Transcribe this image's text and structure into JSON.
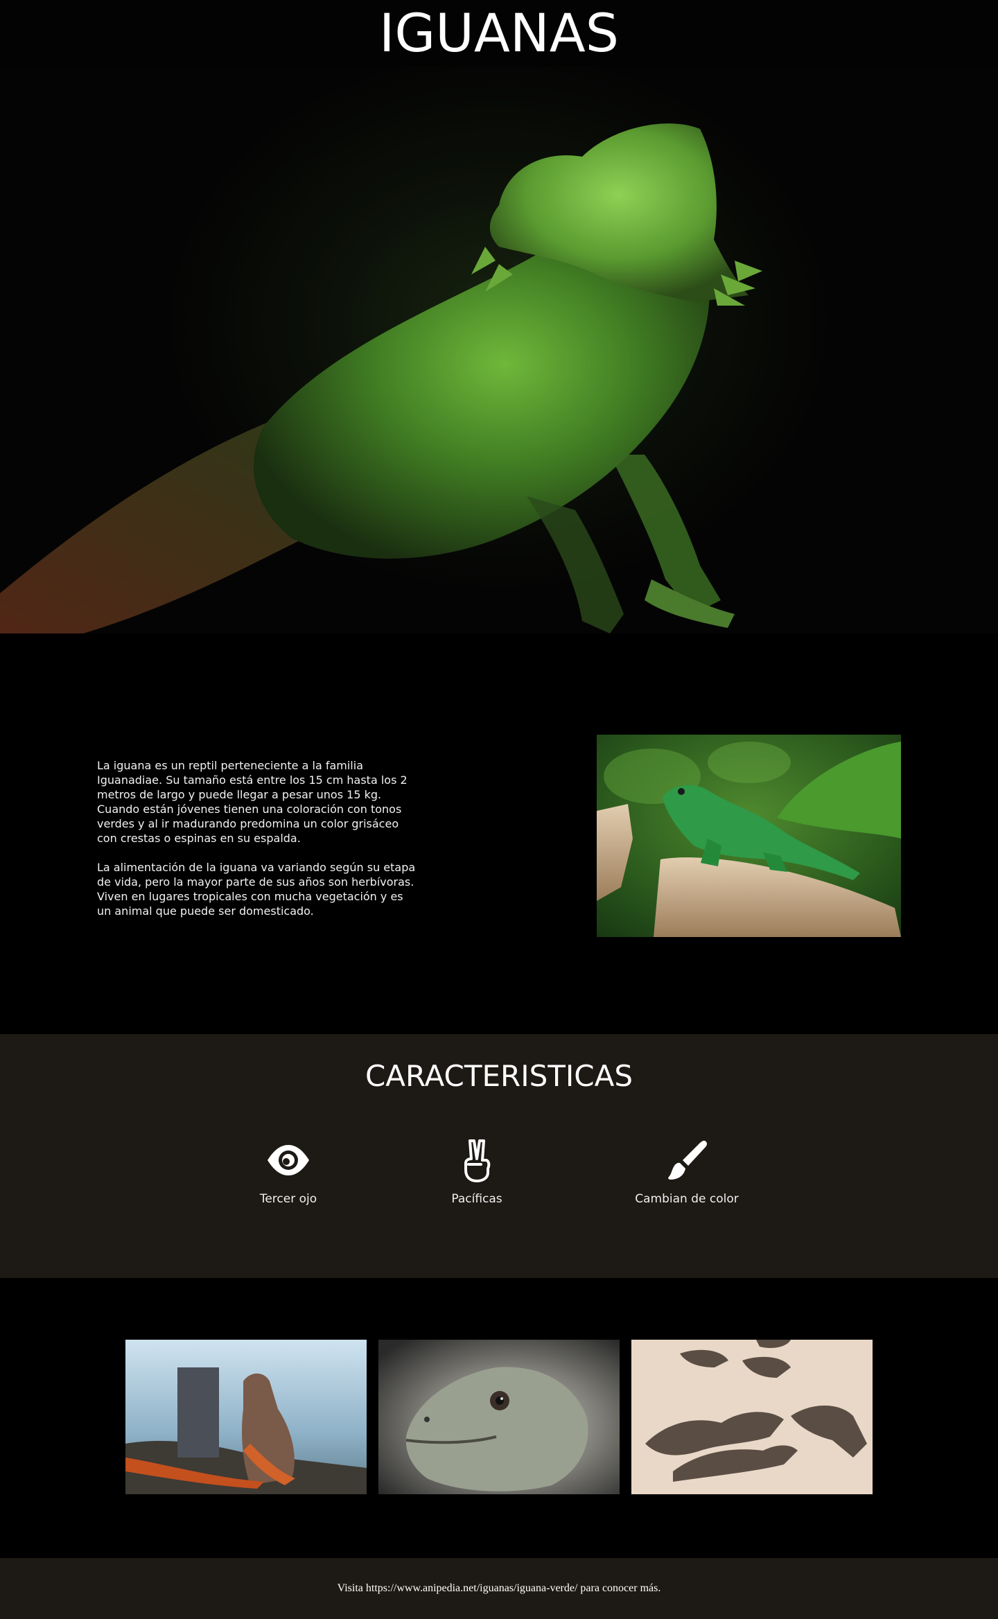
{
  "header": {
    "title": "IGUANAS"
  },
  "hero": {
    "image": "green-bearded-dragon-photo"
  },
  "intro": {
    "paragraphs": [
      "La iguana es un reptil perteneciente a la familia Iguanadiae. Su tamaño está entre los 15 cm hasta los 2 metros de largo y puede llegar a pesar unos 15 kg. Cuando están jóvenes tienen una coloración con tonos verdes y al ir madurando predomina un color grisáceo con crestas o espinas en su espalda.",
      "La alimentación de la iguana va variando según su etapa de vida, pero la mayor parte de sus años son herbívoras. Viven en lugares tropicales con mucha vegetación y es un animal que puede ser domesticado."
    ],
    "image": "green-iguana-on-stump-photo"
  },
  "features": {
    "title": "CARACTERISTICAS",
    "items": [
      {
        "icon": "eye-icon",
        "label": "Tercer ojo"
      },
      {
        "icon": "peace-hand-icon",
        "label": "Pacíficas"
      },
      {
        "icon": "paint-brush-icon",
        "label": "Cambian de color"
      }
    ]
  },
  "gallery": {
    "images": [
      "orange-iguana-beach-photo",
      "iguana-head-closeup-photo",
      "iguanas-on-sand-photo"
    ]
  },
  "footer": {
    "text": "Visita https://www.anipedia.net/iguanas/iguana-verde/ para conocer más."
  },
  "colors": {
    "page_bg": "#000000",
    "band_bg": "#1d1914",
    "text": "#ffffff"
  }
}
